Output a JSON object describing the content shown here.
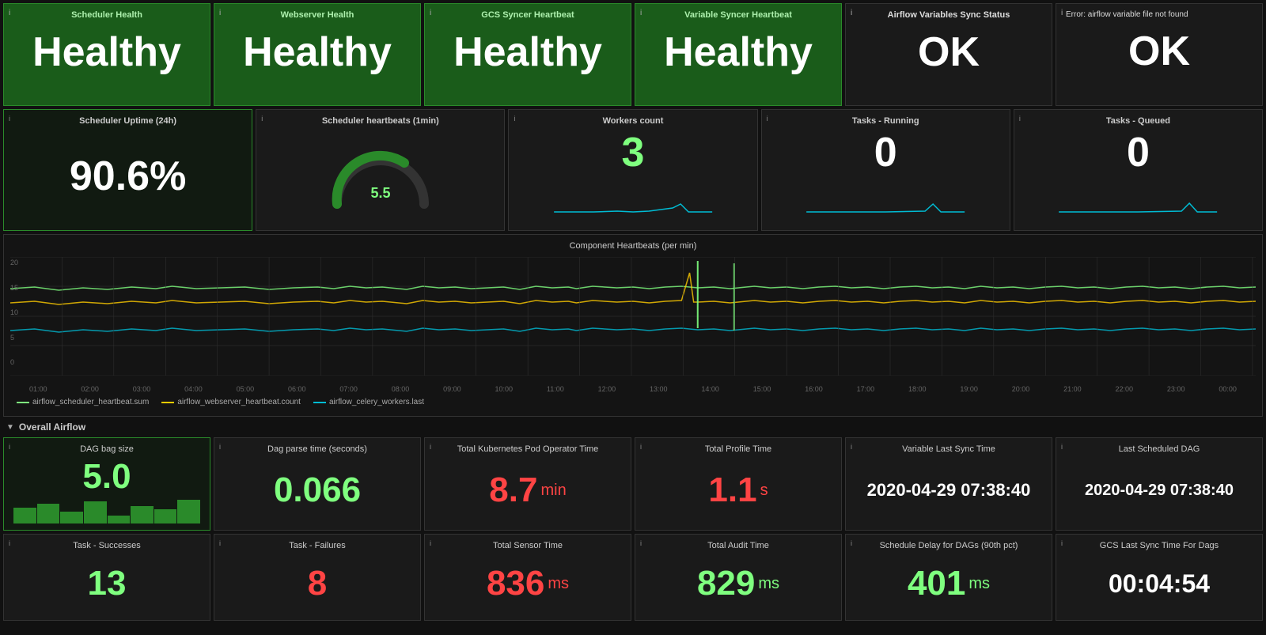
{
  "topCards": [
    {
      "id": "scheduler-health",
      "title": "Scheduler Health",
      "value": "Healthy",
      "type": "green"
    },
    {
      "id": "webserver-health",
      "title": "Webserver Health",
      "value": "Healthy",
      "type": "green"
    },
    {
      "id": "gcs-syncer-heartbeat",
      "title": "GCS Syncer Heartbeat",
      "value": "Healthy",
      "type": "green"
    },
    {
      "id": "variable-syncer-heartbeat",
      "title": "Variable Syncer Heartbeat",
      "value": "Healthy",
      "type": "green"
    },
    {
      "id": "airflow-variables-sync-status",
      "title": "Airflow Variables Sync Status",
      "value": "OK",
      "type": "dark"
    },
    {
      "id": "error-card",
      "title": "Error: airflow variable file not found",
      "value": "OK",
      "type": "dark"
    }
  ],
  "metricsCards": [
    {
      "id": "scheduler-uptime",
      "title": "Scheduler Uptime (24h)",
      "value": "90.6%",
      "type": "uptime",
      "border": "green"
    },
    {
      "id": "scheduler-heartbeats",
      "title": "Scheduler heartbeats (1min)",
      "value": "5.5",
      "type": "gauge",
      "border": "normal"
    },
    {
      "id": "workers-count",
      "title": "Workers count",
      "value": "3",
      "type": "number",
      "color": "green",
      "border": "normal"
    },
    {
      "id": "tasks-running",
      "title": "Tasks - Running",
      "value": "0",
      "type": "number",
      "color": "white",
      "border": "normal"
    },
    {
      "id": "tasks-queued",
      "title": "Tasks - Queued",
      "value": "0",
      "type": "number",
      "color": "white",
      "border": "normal"
    }
  ],
  "chart": {
    "title": "Component Heartbeats (per min)",
    "yLabels": [
      "20",
      "15",
      "10",
      "5",
      "0"
    ],
    "xLabels": [
      "01:00",
      "02:00",
      "03:00",
      "04:00",
      "05:00",
      "06:00",
      "07:00",
      "08:00",
      "09:00",
      "10:00",
      "11:00",
      "12:00",
      "13:00",
      "14:00",
      "15:00",
      "16:00",
      "17:00",
      "18:00",
      "19:00",
      "20:00",
      "21:00",
      "22:00",
      "23:00",
      "00:00"
    ],
    "legend": [
      {
        "label": "airflow_scheduler_heartbeat.sum",
        "color": "#7fff7f"
      },
      {
        "label": "airflow_webserver_heartbeat.count",
        "color": "#ffcc00"
      },
      {
        "label": "airflow_celery_workers.last",
        "color": "#00bcd4"
      }
    ]
  },
  "sectionTitle": "Overall Airflow",
  "overallRow1": [
    {
      "id": "dag-bag-size",
      "title": "DAG bag size",
      "value": "5.0",
      "unit": "",
      "color": "green",
      "hasChart": true
    },
    {
      "id": "dag-parse-time",
      "title": "Dag parse time (seconds)",
      "value": "0.066",
      "unit": "",
      "color": "green"
    },
    {
      "id": "k8s-pod-time",
      "title": "Total Kubernetes Pod Operator Time",
      "value": "8.7",
      "unit": "min",
      "color": "red"
    },
    {
      "id": "total-profile-time",
      "title": "Total Profile Time",
      "value": "1.1",
      "unit": "s",
      "color": "red"
    },
    {
      "id": "variable-last-sync",
      "title": "Variable Last Sync Time",
      "value": "2020-04-29 07:38:40",
      "unit": "",
      "color": "white",
      "small": true
    },
    {
      "id": "last-scheduled-dag",
      "title": "Last Scheduled DAG",
      "value": "2020-04-29 07:38:40",
      "unit": "",
      "color": "white",
      "small": true
    }
  ],
  "overallRow2": [
    {
      "id": "task-successes",
      "title": "Task - Successes",
      "value": "13",
      "unit": "",
      "color": "green"
    },
    {
      "id": "task-failures",
      "title": "Task - Failures",
      "value": "8",
      "unit": "",
      "color": "red"
    },
    {
      "id": "total-sensor-time",
      "title": "Total Sensor Time",
      "value": "836",
      "unit": "ms",
      "color": "red"
    },
    {
      "id": "total-audit-time",
      "title": "Total Audit Time",
      "value": "829",
      "unit": "ms",
      "color": "green"
    },
    {
      "id": "schedule-delay",
      "title": "Schedule Delay for DAGs (90th pct)",
      "value": "401",
      "unit": "ms",
      "color": "green"
    },
    {
      "id": "gcs-last-sync",
      "title": "GCS Last Sync Time For Dags",
      "value": "00:04:54",
      "unit": "",
      "color": "white",
      "small": true
    }
  ]
}
